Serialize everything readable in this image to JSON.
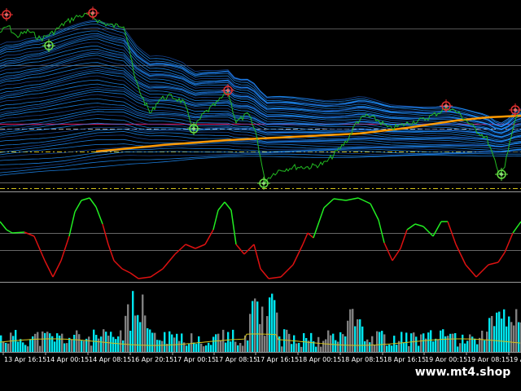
{
  "time_axis": {
    "labels": [
      "13 Apr 16:15",
      "14 Apr 00:15",
      "14 Apr 08:15",
      "16 Apr 20:15",
      "17 Apr 00:15",
      "17 Apr 08:15",
      "17 Apr 16:15",
      "18 Apr 00:15",
      "18 Apr 08:15",
      "18 Apr 16:15",
      "19 Apr 00:15",
      "19 Apr 08:15",
      "19 A"
    ]
  },
  "colors": {
    "background": "#000000",
    "price_line": "#22bb22",
    "ma_line": "#ff9900",
    "band_main": "#1e90ff",
    "band_dark": "#1a4fa8",
    "hline_red": "#c2185b",
    "hline_yellow": "#d4c21a",
    "osc_up": "#22ee22",
    "osc_down": "#dd1111",
    "vol_high": "#00e5ee",
    "vol_low": "#808080",
    "vol_avg": "#d4c21a"
  },
  "icons": {
    "top_marker": "red-crosshair-icon",
    "bottom_marker": "green-crosshair-icon"
  },
  "watermark": "www.mt4.shop"
}
